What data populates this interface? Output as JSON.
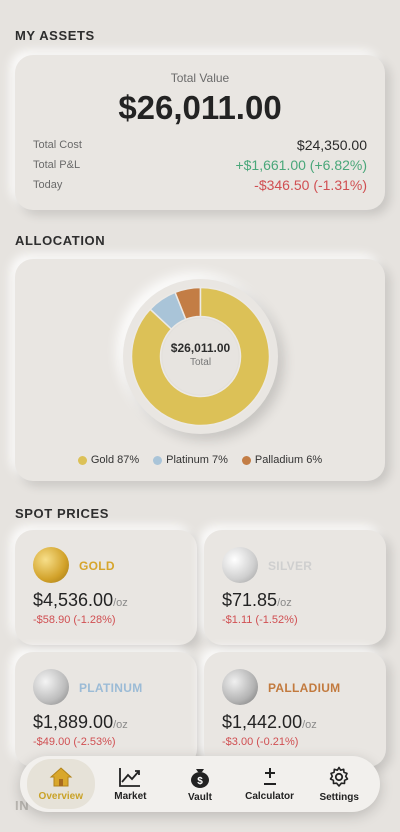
{
  "assets": {
    "section_title": "MY ASSETS",
    "total_label": "Total Value",
    "total_value": "$26,011.00",
    "rows": [
      {
        "label": "Total Cost",
        "value": "$24,350.00"
      },
      {
        "label": "Total P&L",
        "value": "+$1,661.00 (+6.82%)"
      },
      {
        "label": "Today",
        "value": "-$346.50 (-1.31%)"
      }
    ]
  },
  "allocation": {
    "section_title": "ALLOCATION",
    "center_value": "$26,011.00",
    "center_label": "Total",
    "slices": [
      {
        "name": "Gold",
        "percent": 87,
        "color": "#dcc157",
        "legend": "Gold 87%"
      },
      {
        "name": "Platinum",
        "percent": 7,
        "color": "#a9c4d8",
        "legend": "Platinum 7%"
      },
      {
        "name": "Palladium",
        "percent": 6,
        "color": "#c37d45",
        "legend": "Palladium 6%"
      }
    ]
  },
  "spot": {
    "section_title": "SPOT PRICES",
    "metals": [
      {
        "name": "GOLD",
        "price": "$4,536.00",
        "unit": "/oz",
        "change": "-$58.90 (-1.28%)",
        "color": "#d6a52c",
        "coin": "gold-coin-icon"
      },
      {
        "name": "SILVER",
        "price": "$71.85",
        "unit": "/oz",
        "change": "-$1.11 (-1.52%)",
        "color": "#cfcfcf",
        "coin": "silver-coin-icon"
      },
      {
        "name": "PLATINUM",
        "price": "$1,889.00",
        "unit": "/oz",
        "change": "-$49.00 (-2.53%)",
        "color": "#9bbbd6",
        "coin": "platinum-coin-icon"
      },
      {
        "name": "PALLADIUM",
        "price": "$1,442.00",
        "unit": "/oz",
        "change": "-$3.00 (-0.21%)",
        "color": "#c27a3e",
        "coin": "palladium-coin-icon"
      }
    ]
  },
  "faded_section": "IN",
  "nav": {
    "items": [
      {
        "label": "Overview",
        "icon": "home-icon",
        "active": true
      },
      {
        "label": "Market",
        "icon": "chart-trend-icon",
        "active": false
      },
      {
        "label": "Vault",
        "icon": "money-bag-icon",
        "active": false
      },
      {
        "label": "Calculator",
        "icon": "plus-minus-icon",
        "active": false
      },
      {
        "label": "Settings",
        "icon": "gear-icon",
        "active": false
      }
    ]
  },
  "colors": {
    "positive": "#4aa77a",
    "negative": "#d04f52",
    "accent": "#c9a227"
  }
}
